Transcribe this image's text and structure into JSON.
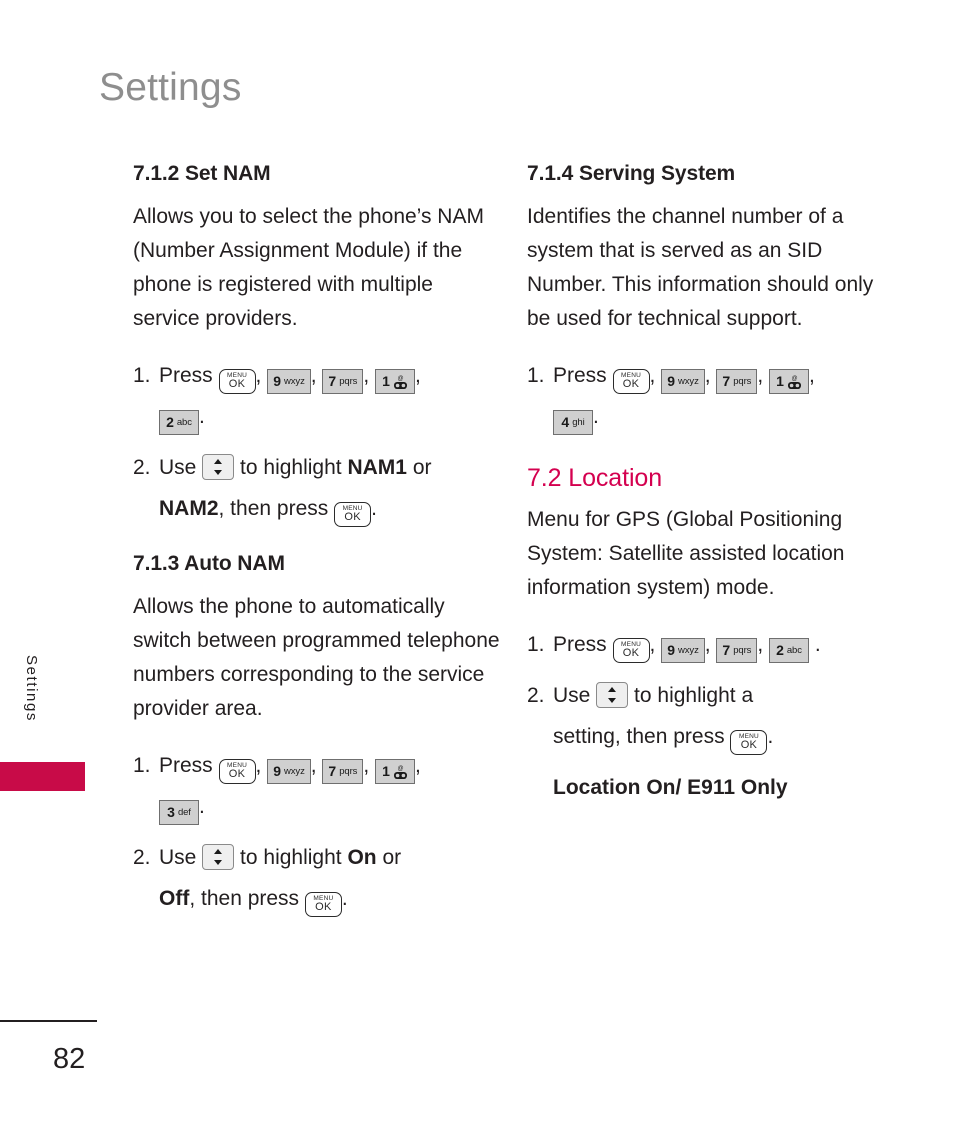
{
  "page": {
    "title": "Settings",
    "side_tab_label": "Settings",
    "folio": "82",
    "accent_color": "#c80b48",
    "heading_accent_color": "#d4004f"
  },
  "keys": {
    "menu_ok": {
      "top": "MENU",
      "bottom": "OK",
      "name": "menu-ok-key"
    },
    "num1": {
      "digit": "1",
      "letters": "",
      "icon": "voicemail-icon"
    },
    "num2": {
      "digit": "2",
      "letters": "abc"
    },
    "num3": {
      "digit": "3",
      "letters": "def"
    },
    "num4": {
      "digit": "4",
      "letters": "ghi"
    },
    "num7": {
      "digit": "7",
      "letters": "pqrs"
    },
    "num9": {
      "digit": "9",
      "letters": "wxyz"
    },
    "nav": {
      "name": "up-down-navigation-key"
    }
  },
  "left_column": {
    "section_712": {
      "heading": "7.1.2 Set NAM",
      "body": "Allows you to select the phone’s NAM (Number Assignment Module) if the phone is registered with multiple service providers.",
      "step1": {
        "num": "1.",
        "lead": "Press",
        "tail": "."
      },
      "step2": {
        "num": "2.",
        "lead": "Use",
        "mid": "to highlight",
        "bold1": "NAM1",
        "conj": "or",
        "bold2": "NAM2",
        "tail": ", then press",
        "end": "."
      }
    },
    "section_713": {
      "heading": "7.1.3 Auto NAM",
      "body": "Allows the phone to automatically switch between programmed telephone numbers corresponding to the service provider area.",
      "step1": {
        "num": "1.",
        "lead": "Press",
        "tail": "."
      },
      "step2": {
        "num": "2.",
        "lead": "Use",
        "mid": "to highlight",
        "bold1": "On",
        "conj": "or",
        "bold2": "Off",
        "tail": ", then press",
        "end": "."
      }
    }
  },
  "right_column": {
    "section_714": {
      "heading": "7.1.4 Serving System",
      "body": "Identifies the channel number of a system that is served as an SID Number. This information should only be used for technical support.",
      "step1": {
        "num": "1.",
        "lead": "Press",
        "tail": "."
      }
    },
    "section_72": {
      "heading": "7.2 Location",
      "body": "Menu for GPS (Global Positioning System: Satellite assisted location information system) mode.",
      "step1": {
        "num": "1.",
        "lead": "Press",
        "tail": "."
      },
      "step2": {
        "num": "2.",
        "lead": "Use",
        "mid": "to highlight a",
        "cont": "setting, then press",
        "end": "."
      },
      "options_line": "Location On/ E911  Only"
    }
  },
  "punct": {
    "comma": ",",
    "period": "."
  }
}
